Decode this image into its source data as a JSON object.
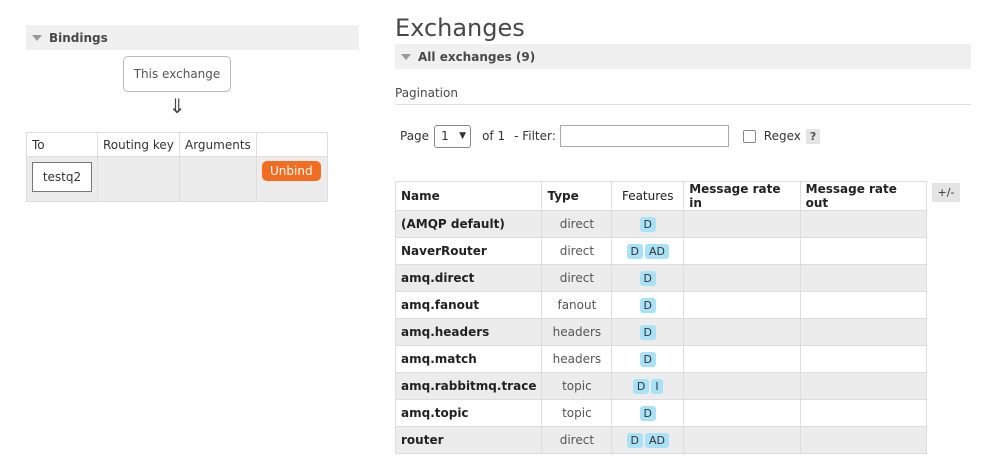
{
  "bindings": {
    "section_title": "Bindings",
    "source_label": "This exchange",
    "arrow": "⇓",
    "columns": [
      "To",
      "Routing key",
      "Arguments",
      ""
    ],
    "rows": [
      {
        "to": "testq2",
        "routing_key": "",
        "arguments": "",
        "action": "Unbind"
      }
    ],
    "unbind_color": "#f26d21"
  },
  "exchanges": {
    "title": "Exchanges",
    "section_title": "All exchanges (9)",
    "pagination_label": "Pagination",
    "pager": {
      "page_label": "Page",
      "page_value": "1",
      "of_label": "of 1",
      "filter_label": "- Filter:",
      "filter_value": "",
      "regex_label": "Regex",
      "regex_checked": false,
      "help": "?"
    },
    "columns": [
      "Name",
      "Type",
      "Features",
      "Message rate in",
      "Message rate out"
    ],
    "toggle_columns": "+/-",
    "rows": [
      {
        "name": "(AMQP default)",
        "type": "direct",
        "features": [
          "D"
        ],
        "rate_in": "",
        "rate_out": ""
      },
      {
        "name": "NaverRouter",
        "type": "direct",
        "features": [
          "D",
          "AD"
        ],
        "rate_in": "",
        "rate_out": ""
      },
      {
        "name": "amq.direct",
        "type": "direct",
        "features": [
          "D"
        ],
        "rate_in": "",
        "rate_out": ""
      },
      {
        "name": "amq.fanout",
        "type": "fanout",
        "features": [
          "D"
        ],
        "rate_in": "",
        "rate_out": ""
      },
      {
        "name": "amq.headers",
        "type": "headers",
        "features": [
          "D"
        ],
        "rate_in": "",
        "rate_out": ""
      },
      {
        "name": "amq.match",
        "type": "headers",
        "features": [
          "D"
        ],
        "rate_in": "",
        "rate_out": ""
      },
      {
        "name": "amq.rabbitmq.trace",
        "type": "topic",
        "features": [
          "D",
          "I"
        ],
        "rate_in": "",
        "rate_out": ""
      },
      {
        "name": "amq.topic",
        "type": "topic",
        "features": [
          "D"
        ],
        "rate_in": "",
        "rate_out": ""
      },
      {
        "name": "router",
        "type": "direct",
        "features": [
          "D",
          "AD"
        ],
        "rate_in": "",
        "rate_out": ""
      }
    ],
    "badge_color": "#a9e1f6"
  }
}
